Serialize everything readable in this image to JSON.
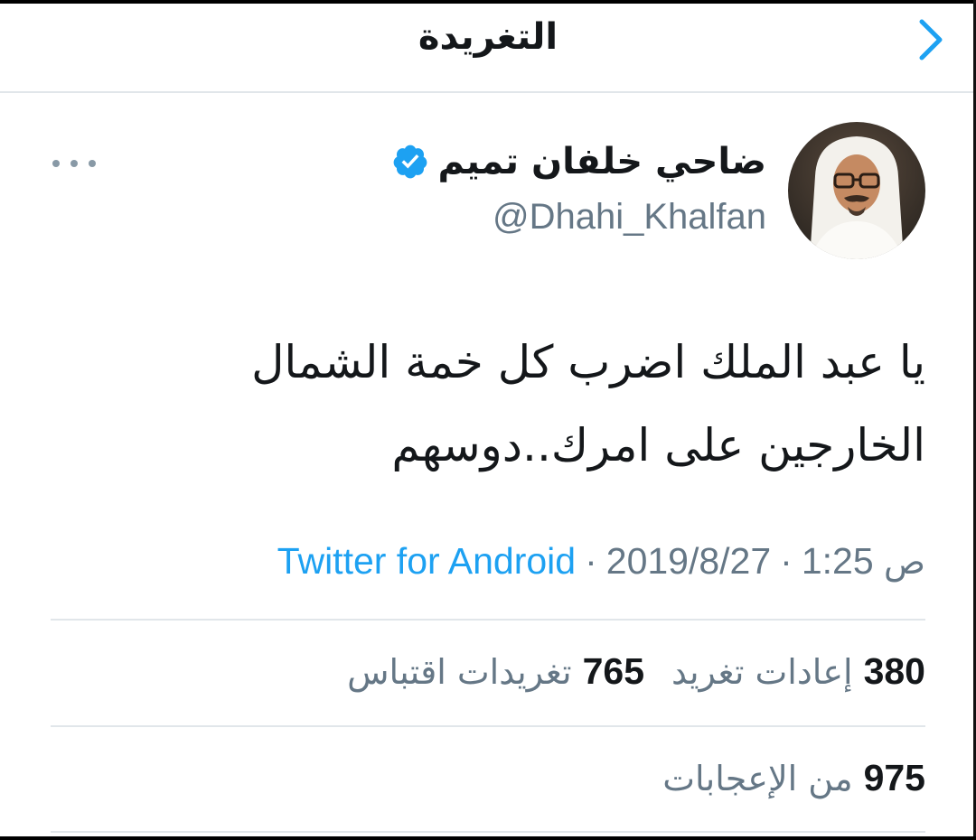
{
  "header": {
    "title": "التغريدة",
    "back_icon": "chevron-right-icon",
    "accent_color": "#1da1f2"
  },
  "author": {
    "display_name": "ضاحي خلفان تميم",
    "handle": "@Dhahi_Khalfan",
    "verified": true,
    "verified_icon": "verified-badge-icon",
    "avatar_icon": "avatar-photo"
  },
  "more_icon": "more-horizontal-icon",
  "tweet": {
    "lines": [
      "يا عبد الملك اضرب كل خمة الشمال",
      "الخارجين على امرك..دوسهم"
    ]
  },
  "meta": {
    "date": "2019/8/27",
    "time": "1:25",
    "ampm": "ص",
    "separator": "·",
    "source": "Twitter for Android"
  },
  "stats": {
    "retweets": {
      "count": "380",
      "label": "إعادات تغريد"
    },
    "quotes": {
      "count": "765",
      "label": "تغريدات اقتباس"
    },
    "likes": {
      "count": "975",
      "label": "من الإعجابات"
    }
  },
  "colors": {
    "text_primary": "#14171a",
    "text_secondary": "#657786",
    "link": "#1da1f2",
    "divider": "#e1e6ea"
  }
}
